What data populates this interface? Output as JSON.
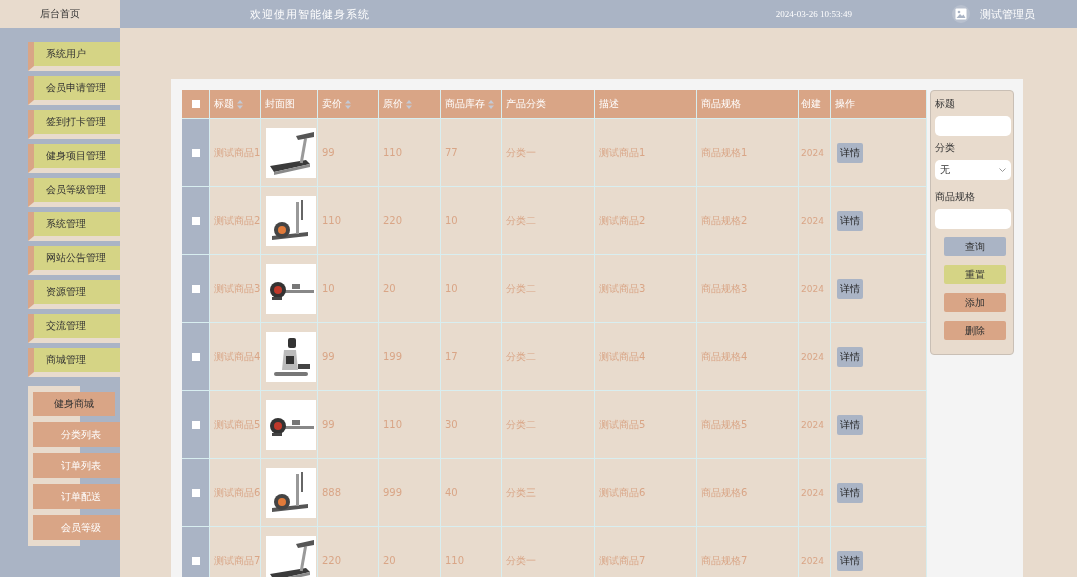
{
  "header": {
    "title": "欢迎使用智能健身系统",
    "datetime": "2024-03-26 10:53:49",
    "user": "测试管理员"
  },
  "sidebar": {
    "home": "后台首页",
    "items": [
      {
        "label": "系统用户"
      },
      {
        "label": "会员申请管理"
      },
      {
        "label": "签到打卡管理"
      },
      {
        "label": "健身项目管理"
      },
      {
        "label": "会员等级管理"
      },
      {
        "label": "系统管理"
      },
      {
        "label": "网站公告管理"
      },
      {
        "label": "资源管理"
      },
      {
        "label": "交流管理"
      },
      {
        "label": "商城管理"
      }
    ],
    "submenu": {
      "title": "健身商城",
      "items": [
        {
          "label": "分类列表"
        },
        {
          "label": "订单列表"
        },
        {
          "label": "订单配送"
        },
        {
          "label": "会员等级"
        }
      ]
    }
  },
  "table": {
    "select_all": {
      "checked": false
    },
    "columns": [
      {
        "label": "标题",
        "sortable": true
      },
      {
        "label": "封面图",
        "sortable": false
      },
      {
        "label": "卖价",
        "sortable": true
      },
      {
        "label": "原价",
        "sortable": true
      },
      {
        "label": "商品库存",
        "sortable": true
      },
      {
        "label": "产品分类",
        "sortable": false
      },
      {
        "label": "描述",
        "sortable": false
      },
      {
        "label": "商品规格",
        "sortable": false
      },
      {
        "label": "创建",
        "sortable": false
      },
      {
        "label": "操作",
        "sortable": false
      }
    ],
    "rows": [
      {
        "checked": false,
        "title": "测试商品1",
        "price": "99",
        "original_price": "110",
        "stock": "77",
        "category": "分类一",
        "description": "测试商品1",
        "spec": "商品规格1",
        "created": "2024",
        "action": "详情"
      },
      {
        "checked": false,
        "title": "测试商品2",
        "price": "110",
        "original_price": "220",
        "stock": "10",
        "category": "分类二",
        "description": "测试商品2",
        "spec": "商品规格2",
        "created": "2024",
        "action": "详情"
      },
      {
        "checked": false,
        "title": "测试商品3",
        "price": "10",
        "original_price": "20",
        "stock": "10",
        "category": "分类二",
        "description": "测试商品3",
        "spec": "商品规格3",
        "created": "2024",
        "action": "详情"
      },
      {
        "checked": false,
        "title": "测试商品4",
        "price": "99",
        "original_price": "199",
        "stock": "17",
        "category": "分类二",
        "description": "测试商品4",
        "spec": "商品规格4",
        "created": "2024",
        "action": "详情"
      },
      {
        "checked": false,
        "title": "测试商品5",
        "price": "99",
        "original_price": "110",
        "stock": "30",
        "category": "分类二",
        "description": "测试商品5",
        "spec": "商品规格5",
        "created": "2024",
        "action": "详情"
      },
      {
        "checked": false,
        "title": "测试商品6",
        "price": "888",
        "original_price": "999",
        "stock": "40",
        "category": "分类三",
        "description": "测试商品6",
        "spec": "商品规格6",
        "created": "2024",
        "action": "详情"
      },
      {
        "checked": false,
        "title": "测试商品7",
        "price": "220",
        "original_price": "20",
        "stock": "110",
        "category": "分类一",
        "description": "测试商品7",
        "spec": "商品规格7",
        "created": "2024",
        "action": "详情"
      }
    ]
  },
  "search": {
    "title_label": "标题",
    "category_label": "分类",
    "category_value": "无",
    "spec_label": "商品规格",
    "buttons": [
      {
        "label": "查询",
        "kind": "query"
      },
      {
        "label": "重置",
        "kind": "reset"
      },
      {
        "label": "添加",
        "kind": "add"
      },
      {
        "label": "删除",
        "kind": "delete"
      }
    ]
  }
}
